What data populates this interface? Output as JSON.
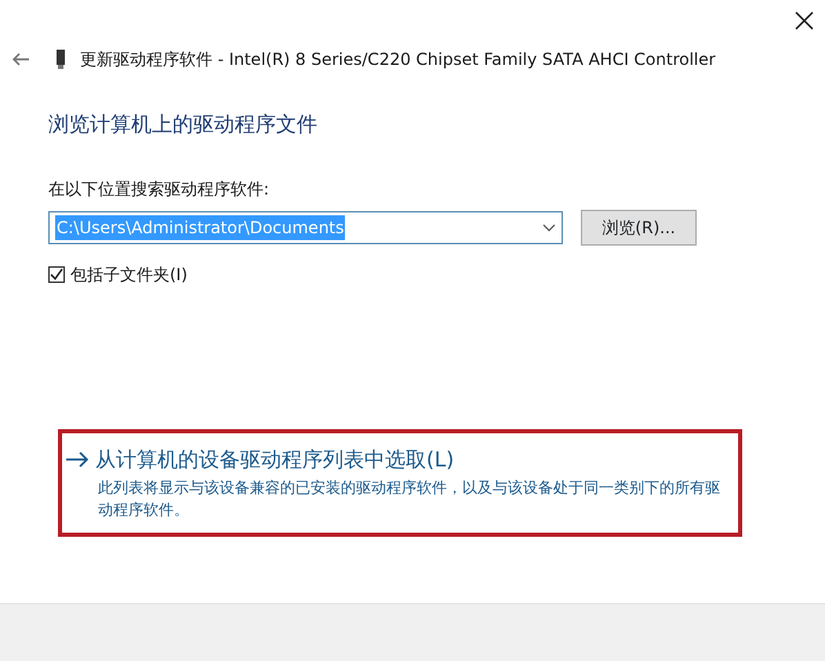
{
  "window": {
    "title": "更新驱动程序软件 - Intel(R) 8 Series/C220 Chipset Family SATA AHCI Controller"
  },
  "heading": "浏览计算机上的驱动程序文件",
  "search": {
    "label": "在以下位置搜索驱动程序软件:",
    "value": "C:\\Users\\Administrator\\Documents",
    "text_selected": true,
    "browse_button": "浏览(R)..."
  },
  "include_subfolders": {
    "label": "包括子文件夹(I)",
    "checked": true
  },
  "pick_option": {
    "title": "从计算机的设备驱动程序列表中选取(L)",
    "description": "此列表将显示与该设备兼容的已安装的驱动程序软件，以及与该设备处于同一类别下的所有驱动程序软件。",
    "highlighted": true
  }
}
